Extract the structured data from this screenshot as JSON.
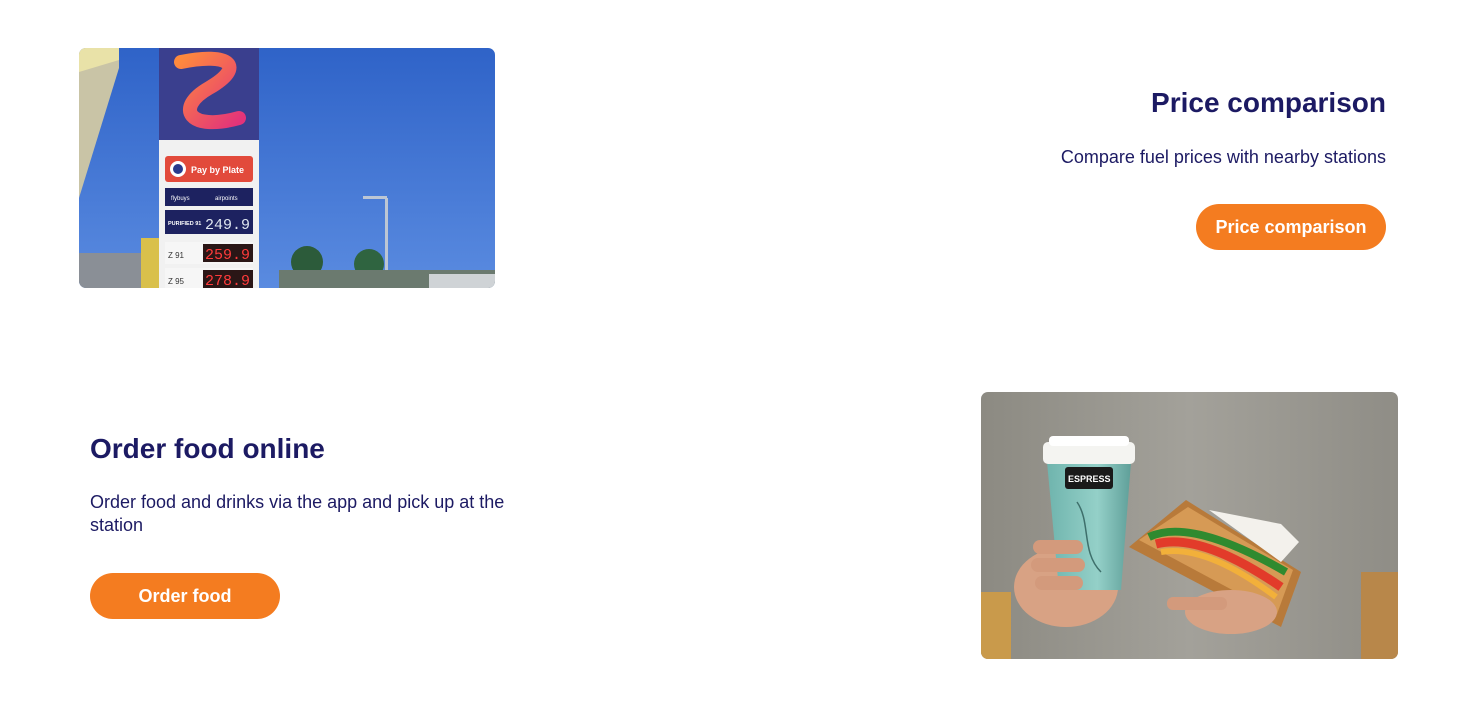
{
  "features": [
    {
      "title": "Price comparison",
      "description": "Compare fuel prices with nearby stations",
      "button_label": "Price comparison",
      "image": "fuel-station-price-sign-photo",
      "sign_text": {
        "pay_by_plate": "Pay by Plate",
        "flybuys": "flybuys",
        "airpoints": "airpoints",
        "purified": "PURIFIED 91",
        "price_purified": "249.9",
        "grade_1": "Z 91",
        "price_1": "259.9",
        "grade_2": "Z 95",
        "price_2": "278.9"
      }
    },
    {
      "title": "Order food online",
      "description": "Order food and drinks via the app and pick up at the station",
      "button_label": "Order food",
      "image": "coffee-and-sandwich-photo",
      "cup_text": "ESPRESS"
    }
  ],
  "colors": {
    "heading": "#1c1a63",
    "button": "#f47c20",
    "button_text": "#ffffff",
    "background": "#ffffff"
  }
}
